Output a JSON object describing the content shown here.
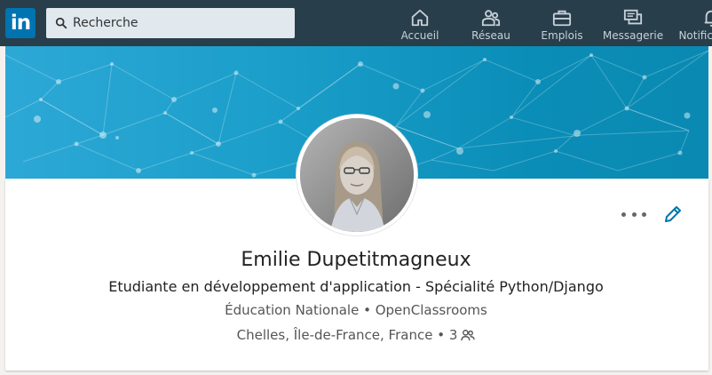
{
  "topbar": {
    "logo_text": "in",
    "search_placeholder": "Recherche",
    "nav": [
      {
        "label": "Accueil",
        "icon": "home-icon"
      },
      {
        "label": "Réseau",
        "icon": "network-icon"
      },
      {
        "label": "Emplois",
        "icon": "briefcase-icon"
      },
      {
        "label": "Messagerie",
        "icon": "messaging-icon"
      },
      {
        "label": "Notifications",
        "icon": "bell-icon"
      }
    ]
  },
  "profile": {
    "name": "Emilie Dupetitmagneux",
    "headline": "Etudiante en développement d'application - Spécialité Python/Django",
    "orgs": "Éducation Nationale • OpenClassrooms",
    "location": "Chelles, Île-de-France, France • 3",
    "connections_icon": "people-icon"
  },
  "colors": {
    "topbar": "#283e4a",
    "brand": "#0073b1",
    "banner": "#1a9ec9",
    "edit_icon": "#0073b1"
  }
}
